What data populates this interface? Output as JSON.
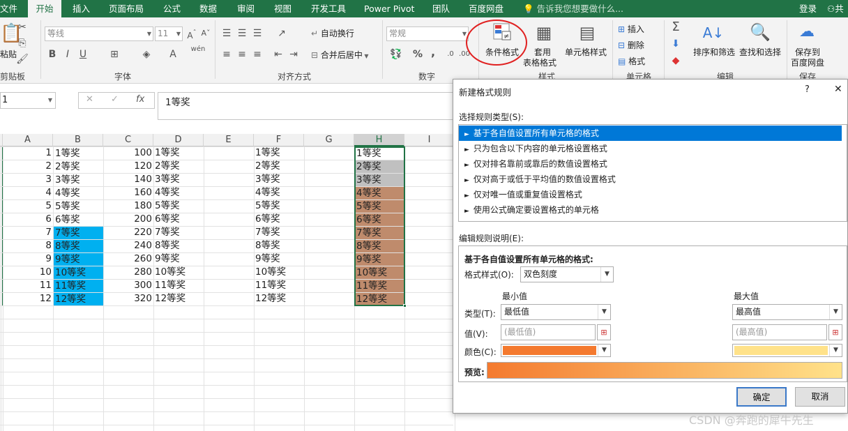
{
  "tabs": [
    "文件",
    "开始",
    "插入",
    "页面布局",
    "公式",
    "数据",
    "审阅",
    "视图",
    "开发工具",
    "Power Pivot",
    "团队",
    "百度网盘"
  ],
  "tell_me": "告诉我您想要做什么...",
  "login": "登录",
  "share": "共",
  "ribbon": {
    "clipboard": {
      "paste": "粘贴",
      "label": "剪贴板"
    },
    "font": {
      "name": "等线",
      "size": "11",
      "bold": "B",
      "italic": "I",
      "underline": "U",
      "wen": "wén",
      "label": "字体"
    },
    "align": {
      "wrap": "自动换行",
      "merge": "合并后居中",
      "label": "对齐方式"
    },
    "number": {
      "format": "常规",
      "percent": "%",
      "comma": ",",
      "label": "数字"
    },
    "styles": {
      "cond": "条件格式",
      "table1": "套用",
      "table2": "表格格式",
      "cellstyle": "单元格样式",
      "label": "样式"
    },
    "cells": {
      "insert": "插入",
      "delete": "删除",
      "format": "格式",
      "label": "单元格"
    },
    "edit": {
      "sum": "Σ",
      "sort": "排序和筛选",
      "find": "查找和选择",
      "label": "编辑"
    },
    "save": {
      "l1": "保存到",
      "l2": "百度网盘",
      "label": "保存"
    }
  },
  "formula_bar": {
    "name_box": "1",
    "cancel": "✕",
    "enter": "✓",
    "fx": "fx",
    "content": "1等奖"
  },
  "columns": [
    "A",
    "B",
    "C",
    "D",
    "E",
    "F",
    "G",
    "H",
    "I"
  ],
  "grid": {
    "A": [
      "1",
      "2",
      "3",
      "4",
      "5",
      "6",
      "7",
      "8",
      "9",
      "10",
      "11",
      "12"
    ],
    "B": [
      "1等奖",
      "2等奖",
      "3等奖",
      "4等奖",
      "5等奖",
      "6等奖",
      "7等奖",
      "8等奖",
      "9等奖",
      "10等奖",
      "11等奖",
      "12等奖"
    ],
    "C": [
      "100",
      "120",
      "140",
      "160",
      "180",
      "200",
      "220",
      "240",
      "260",
      "280",
      "300",
      "320"
    ],
    "D": [
      "1等奖",
      "2等奖",
      "3等奖",
      "4等奖",
      "5等奖",
      "6等奖",
      "7等奖",
      "8等奖",
      "9等奖",
      "10等奖",
      "11等奖",
      "12等奖"
    ],
    "F": [
      "1等奖",
      "2等奖",
      "3等奖",
      "4等奖",
      "5等奖",
      "6等奖",
      "7等奖",
      "8等奖",
      "9等奖",
      "10等奖",
      "11等奖",
      "12等奖"
    ],
    "H": [
      "1等奖",
      "2等奖",
      "3等奖",
      "4等奖",
      "5等奖",
      "6等奖",
      "7等奖",
      "8等奖",
      "9等奖",
      "10等奖",
      "11等奖",
      "12等奖"
    ]
  },
  "colors": {
    "B_fill": "#00b0f0",
    "H_grey": "#c0c0c0",
    "H_brown": "#bf8b6c",
    "excel_green": "#217346",
    "min_color": "#f47a2f",
    "max_color": "#ffe28a"
  },
  "dialog": {
    "title": "新建格式规则",
    "help": "?",
    "close": "✕",
    "select_type_label": "选择规则类型(S):",
    "rule_types": [
      "基于各自值设置所有单元格的格式",
      "只为包含以下内容的单元格设置格式",
      "仅对排名靠前或靠后的数值设置格式",
      "仅对高于或低于平均值的数值设置格式",
      "仅对唯一值或重复值设置格式",
      "使用公式确定要设置格式的单元格"
    ],
    "rule_marker": "►",
    "edit_label": "编辑规则说明(E):",
    "desc_heading": "基于各自值设置所有单元格的格式:",
    "style_label": "格式样式(O):",
    "style_value": "双色刻度",
    "min_header": "最小值",
    "max_header": "最大值",
    "type_label": "类型(T):",
    "min_type": "最低值",
    "max_type": "最高值",
    "value_label": "值(V):",
    "min_value": "(最低值)",
    "max_value": "(最高值)",
    "color_label": "颜色(C):",
    "preview_label": "预览:",
    "ok": "确定",
    "cancel": "取消"
  },
  "watermark": "CSDN @奔跑的犀牛先生"
}
